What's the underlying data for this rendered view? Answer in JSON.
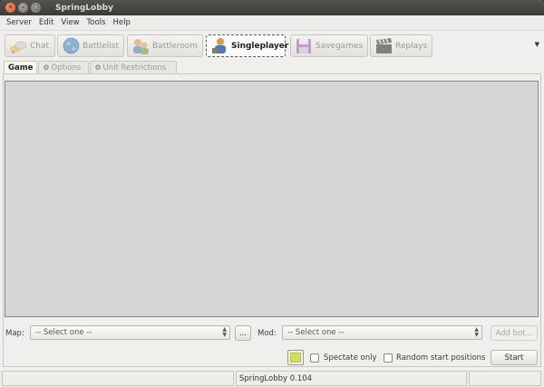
{
  "window": {
    "title": "SpringLobby"
  },
  "menu": [
    "Server",
    "Edit",
    "View",
    "Tools",
    "Help"
  ],
  "main_tabs": [
    {
      "label": "Chat",
      "icon": "chat-icon",
      "active": false
    },
    {
      "label": "Battlelist",
      "icon": "globe-icon",
      "active": false
    },
    {
      "label": "Battleroom",
      "icon": "battleroom-icon",
      "active": false
    },
    {
      "label": "Singleplayer",
      "icon": "singleplayer-icon",
      "active": true
    },
    {
      "label": "Savegames",
      "icon": "floppy-disk-icon",
      "active": false
    },
    {
      "label": "Replays",
      "icon": "clapperboard-icon",
      "active": false
    }
  ],
  "sub_tabs": [
    {
      "label": "Game",
      "active": true
    },
    {
      "label": "Options",
      "active": false
    },
    {
      "label": "Unit Restrictions",
      "active": false
    }
  ],
  "map": {
    "label": "Map:",
    "value": "-- Select one --",
    "browse_label": "..."
  },
  "mod": {
    "label": "Mod:",
    "value": "-- Select one --"
  },
  "add_bot_label": "Add bot...",
  "spectate_label": "Spectate only",
  "random_start_label": "Random start positions",
  "start_label": "Start",
  "status": {
    "version": "SpringLobby 0.104"
  },
  "colors": {
    "player_color": "#d4dd5a",
    "title_bar": "#3b3a36",
    "close_button": "#e0561e"
  }
}
